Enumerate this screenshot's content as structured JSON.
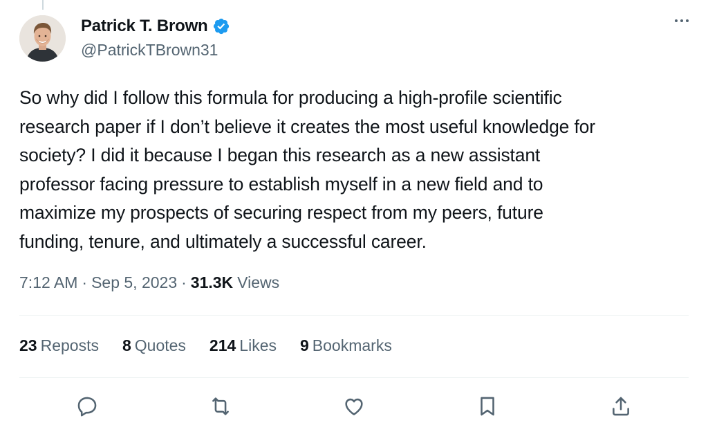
{
  "author": {
    "display_name": "Patrick T. Brown",
    "handle": "@PatrickTBrown31",
    "verified": true
  },
  "tweet": {
    "text": "So why did I follow this formula for producing a high-profile scientific\nresearch paper if I don’t believe it creates the most useful knowledge for\nsociety? I did it because I began this research as a new assistant\nprofessor facing pressure to establish myself in a new field and to\nmaximize my prospects of securing respect from my peers, future\nfunding, tenure, and ultimately a successful career."
  },
  "meta": {
    "time": "7:12 AM",
    "separator": "·",
    "date": "Sep 5, 2023",
    "views_count": "31.3K",
    "views_label": "Views"
  },
  "stats": {
    "reposts": {
      "count": "23",
      "label": "Reposts"
    },
    "quotes": {
      "count": "8",
      "label": "Quotes"
    },
    "likes": {
      "count": "214",
      "label": "Likes"
    },
    "bookmarks": {
      "count": "9",
      "label": "Bookmarks"
    }
  },
  "actions": [
    "reply-icon",
    "repost-icon",
    "like-icon",
    "bookmark-icon",
    "share-icon"
  ],
  "colors": {
    "text_primary": "#0f1419",
    "text_secondary": "#536471",
    "verified_blue": "#1d9bf0",
    "divider": "#eff3f4"
  }
}
